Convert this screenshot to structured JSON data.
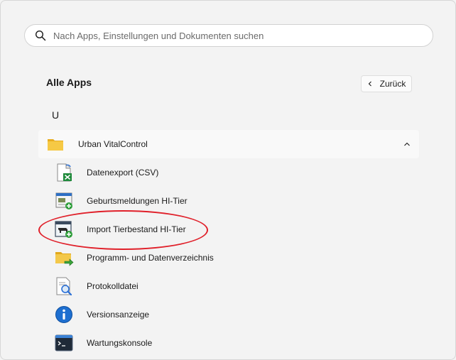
{
  "search": {
    "placeholder": "Nach Apps, Einstellungen und Dokumenten suchen",
    "icon": "search-icon"
  },
  "header": {
    "title": "Alle Apps",
    "back_label": "Zurück"
  },
  "group_letter": "U",
  "folder": {
    "label": "Urban VitalControl",
    "icon": "folder-icon",
    "expanded": true
  },
  "apps": [
    {
      "label": "Datenexport (CSV)",
      "icon": "excel-export-icon"
    },
    {
      "label": "Geburtsmeldungen HI-Tier",
      "icon": "birth-report-icon"
    },
    {
      "label": "Import Tierbestand HI-Tier",
      "icon": "import-livestock-icon"
    },
    {
      "label": "Programm- und Datenverzeichnis",
      "icon": "folder-arrow-icon"
    },
    {
      "label": "Protokolldatei",
      "icon": "log-file-icon"
    },
    {
      "label": "Versionsanzeige",
      "icon": "info-icon"
    },
    {
      "label": "Wartungskonsole",
      "icon": "console-icon"
    }
  ],
  "colors": {
    "highlight": "#e0202a",
    "folder": "#f6c945",
    "info": "#1e6fd0"
  }
}
